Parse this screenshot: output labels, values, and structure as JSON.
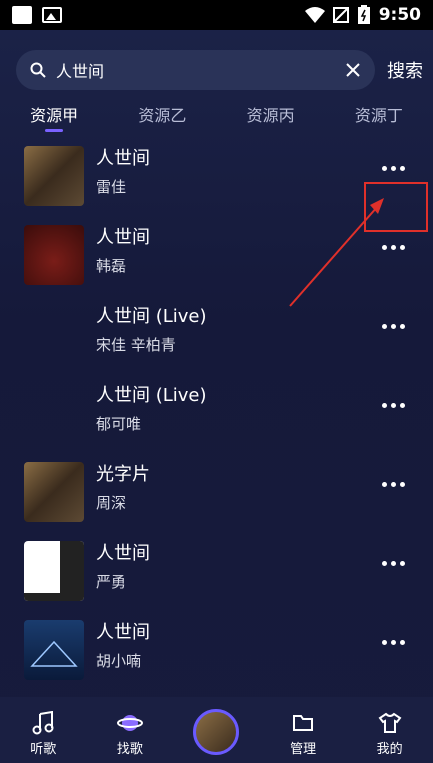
{
  "status_bar": {
    "time": "9:50"
  },
  "search": {
    "value": "人世间",
    "button_label": "搜索"
  },
  "tabs": [
    {
      "label": "资源甲",
      "active": true
    },
    {
      "label": "资源乙",
      "active": false
    },
    {
      "label": "资源丙",
      "active": false
    },
    {
      "label": "资源丁",
      "active": false
    }
  ],
  "songs": [
    {
      "title": "人世间",
      "artist": "雷佳"
    },
    {
      "title": "人世间",
      "artist": "韩磊"
    },
    {
      "title": "人世间 (Live)",
      "artist": "宋佳  辛柏青"
    },
    {
      "title": "人世间 (Live)",
      "artist": "郁可唯"
    },
    {
      "title": "光字片",
      "artist": "周深"
    },
    {
      "title": "人世间",
      "artist": "严勇"
    },
    {
      "title": "人世间",
      "artist": "胡小喃"
    }
  ],
  "bottom_nav": [
    {
      "label": "听歌",
      "icon": "music-note-icon"
    },
    {
      "label": "找歌",
      "icon": "planet-icon"
    },
    {
      "label": "",
      "icon": "now-playing-disc"
    },
    {
      "label": "管理",
      "icon": "folder-icon"
    },
    {
      "label": "我的",
      "icon": "shirt-icon"
    }
  ],
  "colors": {
    "background": "#15193a",
    "accent": "#7a62ff",
    "annotation": "#e0302a"
  }
}
